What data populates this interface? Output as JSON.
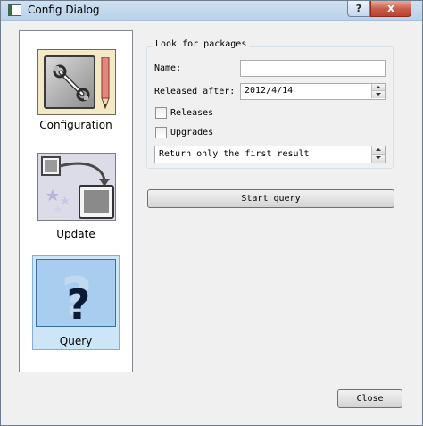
{
  "window": {
    "title": "Config Dialog",
    "help_label": "?",
    "close_label": "x"
  },
  "sidebar": {
    "items": [
      {
        "label": "Configuration",
        "icon": "configuration-icon",
        "selected": false
      },
      {
        "label": "Update",
        "icon": "update-icon",
        "selected": false
      },
      {
        "label": "Query",
        "icon": "query-icon",
        "selected": true
      }
    ]
  },
  "query_page": {
    "group_title": "Look for packages",
    "name_label": "Name:",
    "name_value": "",
    "released_after_label": "Released after:",
    "released_after_value": "2012/4/14",
    "releases_label": "Releases",
    "releases_checked": false,
    "upgrades_label": "Upgrades",
    "upgrades_checked": false,
    "result_option": "Return only the first result",
    "start_query_label": "Start query"
  },
  "footer": {
    "close_button_label": "Close"
  },
  "colors": {
    "selection_background": "#cde6f7",
    "selection_border": "#84acdd",
    "titlebar_close": "#c75a45"
  }
}
